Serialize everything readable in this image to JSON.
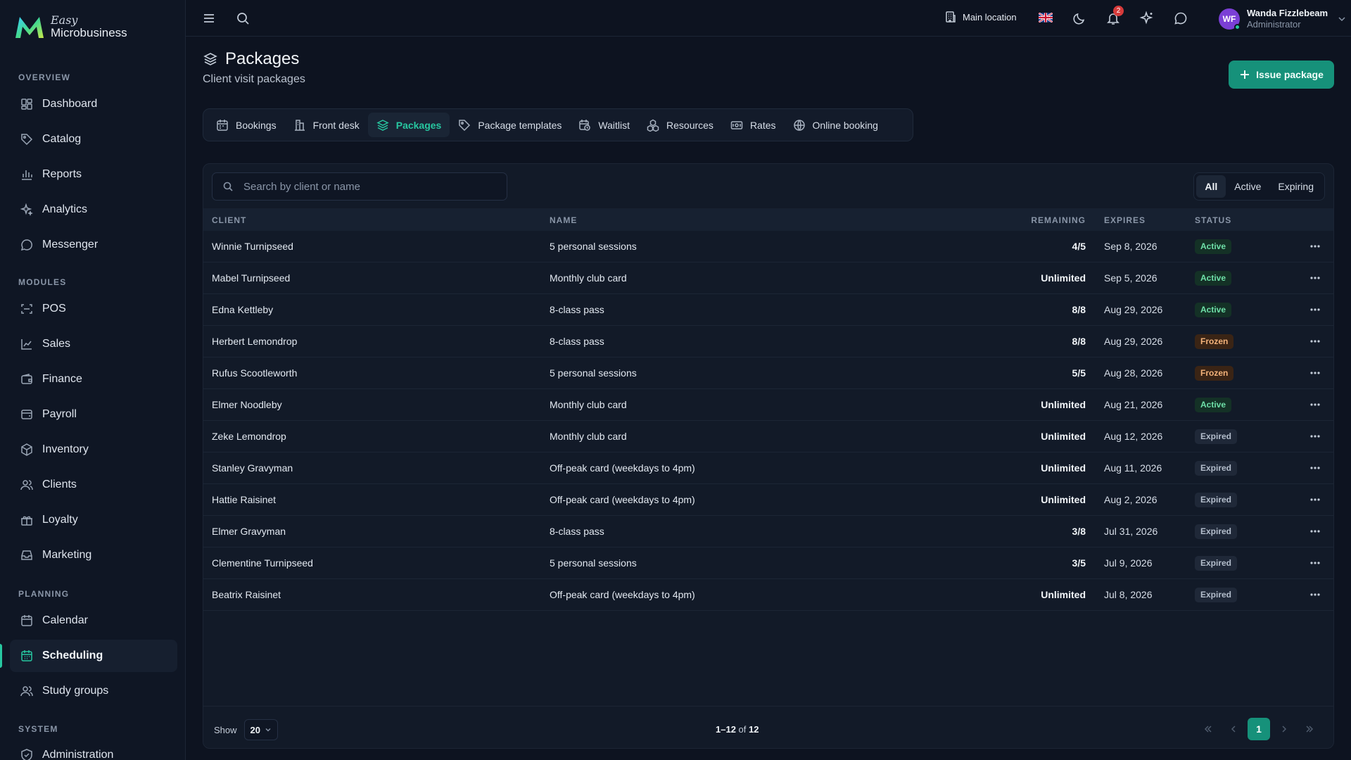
{
  "brand": {
    "small": "Easy",
    "main": "Microbusiness"
  },
  "sidebar": {
    "sections": {
      "overview": "OVERVIEW",
      "modules": "MODULES",
      "planning": "PLANNING",
      "system": "SYSTEM"
    },
    "items": [
      {
        "label": "Dashboard",
        "icon": "dashboard-icon"
      },
      {
        "label": "Catalog",
        "icon": "tag-icon"
      },
      {
        "label": "Reports",
        "icon": "bar-chart-icon"
      },
      {
        "label": "Analytics",
        "icon": "sparkle-icon"
      },
      {
        "label": "Messenger",
        "icon": "chat-icon"
      },
      {
        "label": "POS",
        "icon": "scan-icon"
      },
      {
        "label": "Sales",
        "icon": "line-chart-icon"
      },
      {
        "label": "Finance",
        "icon": "wallet-icon"
      },
      {
        "label": "Payroll",
        "icon": "payroll-icon"
      },
      {
        "label": "Inventory",
        "icon": "box-icon"
      },
      {
        "label": "Clients",
        "icon": "users-icon"
      },
      {
        "label": "Loyalty",
        "icon": "gift-icon"
      },
      {
        "label": "Marketing",
        "icon": "inbox-icon"
      },
      {
        "label": "Calendar",
        "icon": "calendar-icon"
      },
      {
        "label": "Scheduling",
        "icon": "calendar-grid-icon",
        "active": true
      },
      {
        "label": "Study groups",
        "icon": "users-icon"
      },
      {
        "label": "Administration",
        "icon": "shield-icon"
      }
    ]
  },
  "topbar": {
    "location": "Main location",
    "notification_count": "2",
    "user": {
      "initials": "WF",
      "name": "Wanda Fizzlebeam",
      "role": "Administrator"
    }
  },
  "page": {
    "title": "Packages",
    "subtitle": "Client visit packages",
    "issue_button": "Issue package"
  },
  "tabs": [
    {
      "label": "Bookings",
      "icon": "calendar-icon"
    },
    {
      "label": "Front desk",
      "icon": "desk-icon"
    },
    {
      "label": "Packages",
      "icon": "layers-icon",
      "active": true
    },
    {
      "label": "Package templates",
      "icon": "tag-icon"
    },
    {
      "label": "Waitlist",
      "icon": "calendar-clock-icon"
    },
    {
      "label": "Resources",
      "icon": "cubes-icon"
    },
    {
      "label": "Rates",
      "icon": "ticket-icon"
    },
    {
      "label": "Online booking",
      "icon": "globe-icon"
    }
  ],
  "search": {
    "placeholder": "Search by client or name"
  },
  "filters": [
    {
      "label": "All",
      "active": true
    },
    {
      "label": "Active"
    },
    {
      "label": "Expiring"
    }
  ],
  "table": {
    "columns": {
      "client": "CLIENT",
      "name": "NAME",
      "remaining": "REMAINING",
      "expires": "EXPIRES",
      "status": "STATUS"
    },
    "rows": [
      {
        "client": "Winnie Turnipseed",
        "name": "5 personal sessions",
        "remaining": "4/5",
        "expires": "Sep 8, 2026",
        "status": "Active"
      },
      {
        "client": "Mabel Turnipseed",
        "name": "Monthly club card",
        "remaining": "Unlimited",
        "expires": "Sep 5, 2026",
        "status": "Active"
      },
      {
        "client": "Edna Kettleby",
        "name": "8-class pass",
        "remaining": "8/8",
        "expires": "Aug 29, 2026",
        "status": "Active"
      },
      {
        "client": "Herbert Lemondrop",
        "name": "8-class pass",
        "remaining": "8/8",
        "expires": "Aug 29, 2026",
        "status": "Frozen"
      },
      {
        "client": "Rufus Scootleworth",
        "name": "5 personal sessions",
        "remaining": "5/5",
        "expires": "Aug 28, 2026",
        "status": "Frozen"
      },
      {
        "client": "Elmer Noodleby",
        "name": "Monthly club card",
        "remaining": "Unlimited",
        "expires": "Aug 21, 2026",
        "status": "Active"
      },
      {
        "client": "Zeke Lemondrop",
        "name": "Monthly club card",
        "remaining": "Unlimited",
        "expires": "Aug 12, 2026",
        "status": "Expired"
      },
      {
        "client": "Stanley Gravyman",
        "name": "Off-peak card (weekdays to 4pm)",
        "remaining": "Unlimited",
        "expires": "Aug 11, 2026",
        "status": "Expired"
      },
      {
        "client": "Hattie Raisinet",
        "name": "Off-peak card (weekdays to 4pm)",
        "remaining": "Unlimited",
        "expires": "Aug 2, 2026",
        "status": "Expired"
      },
      {
        "client": "Elmer Gravyman",
        "name": "8-class pass",
        "remaining": "3/8",
        "expires": "Jul 31, 2026",
        "status": "Expired"
      },
      {
        "client": "Clementine Turnipseed",
        "name": "5 personal sessions",
        "remaining": "3/5",
        "expires": "Jul 9, 2026",
        "status": "Expired"
      },
      {
        "client": "Beatrix Raisinet",
        "name": "Off-peak card (weekdays to 4pm)",
        "remaining": "Unlimited",
        "expires": "Jul 8, 2026",
        "status": "Expired"
      }
    ]
  },
  "footer": {
    "show_label": "Show",
    "page_size": "20",
    "range": "1–12",
    "of": "of",
    "total": "12",
    "current_page": "1"
  },
  "colors": {
    "accent": "#27c7a0",
    "button": "#16917a",
    "background": "#0d1320",
    "active_status": "#6ee0a8",
    "frozen_status": "#f3b27a"
  }
}
